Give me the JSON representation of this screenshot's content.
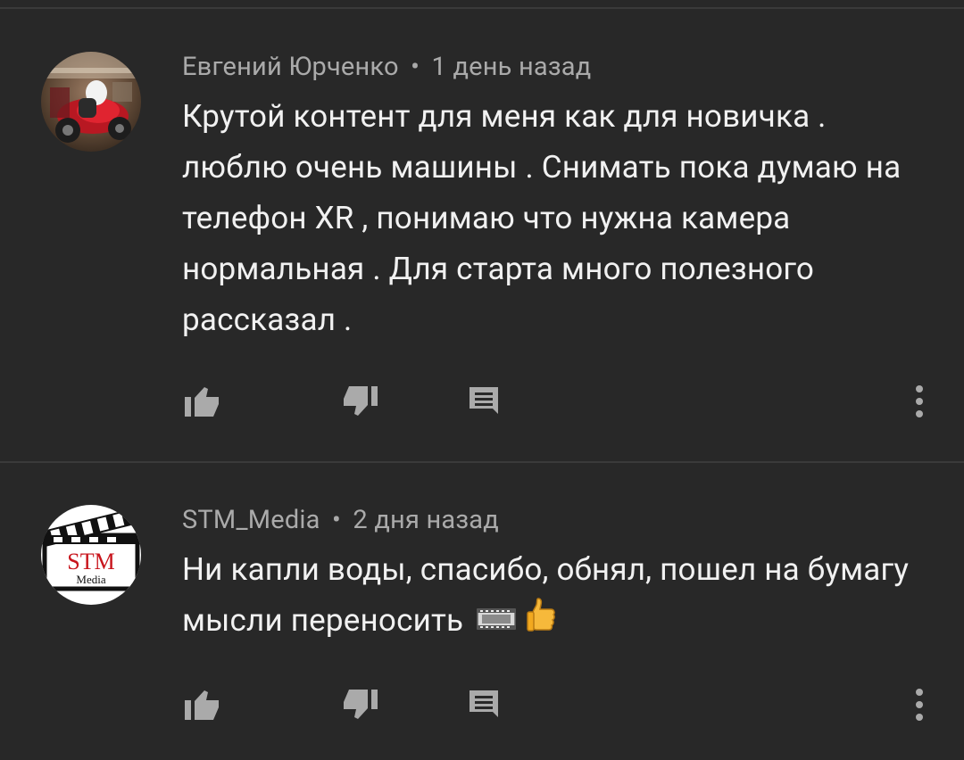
{
  "comments": [
    {
      "author": "Евгений Юрченко",
      "separator": "•",
      "time": "1 день назад",
      "text": "Крутой контент для меня как для новичка . люблю очень машины . Снимать пока думаю на телефон XR , понимаю что нужна камера нормальная . Для старта много полезного рассказал .",
      "avatar_icon": "motorcycle-photo-avatar"
    },
    {
      "author": "STM_Media",
      "separator": "•",
      "time": "2 дня назад",
      "text": "Ни капли воды, спасибо, обнял, пошел на бумагу мысли переносить",
      "emojis": [
        "film-frames-emoji",
        "thumbs-up-emoji"
      ],
      "avatar": {
        "logo_line1": "STM",
        "logo_line2": "Media"
      }
    }
  ],
  "actions": {
    "like_icon": "thumbs-up-icon",
    "dislike_icon": "thumbs-down-icon",
    "reply_icon": "reply-comment-icon",
    "more_icon": "more-vertical-icon"
  },
  "colors": {
    "background": "#282828",
    "divider": "#3a3a3a",
    "meta_text": "#aaaaaa",
    "body_text": "#f1f1f1",
    "icon": "#aaaaaa"
  }
}
